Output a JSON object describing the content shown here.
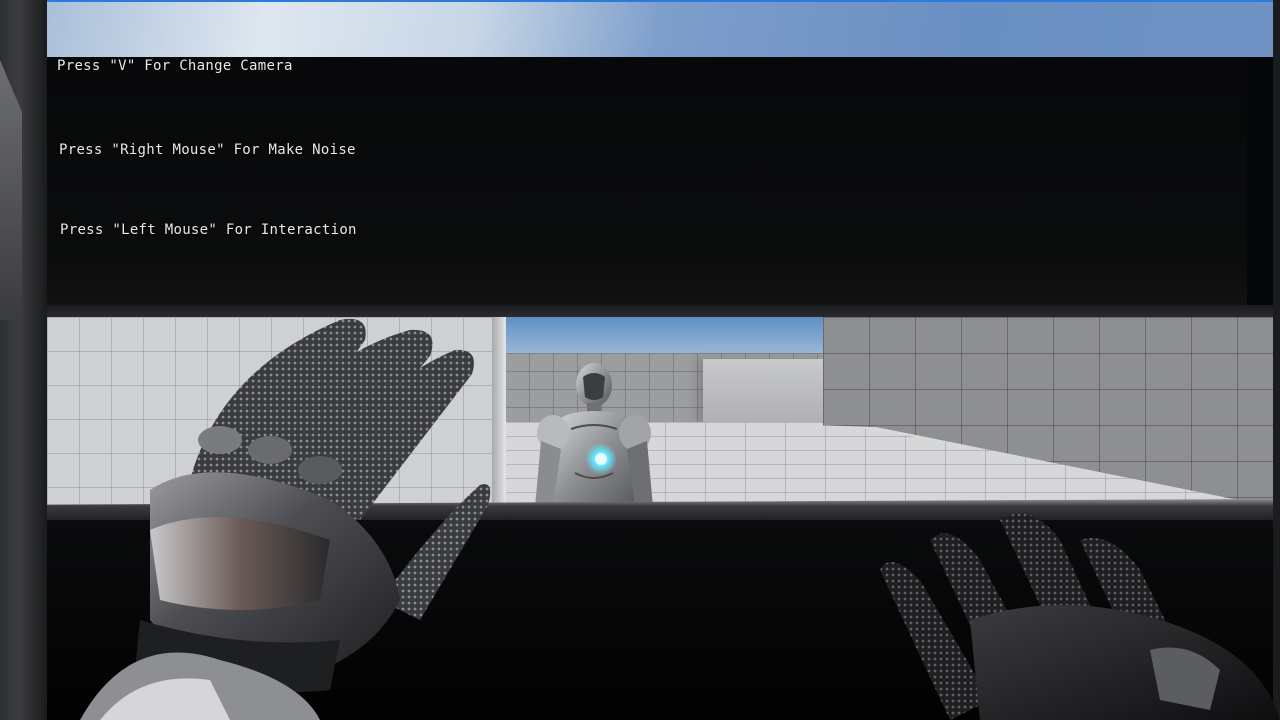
{
  "hud": {
    "lines": [
      "Press \"V\" For Change Camera",
      "Press \"Right Mouse\" For Make Noise",
      "Press \"Left Mouse\" For Interaction"
    ]
  },
  "scene": {
    "character": "robot-npc",
    "hands": [
      "left-gloved-hand",
      "right-gloved-hand"
    ]
  },
  "colors": {
    "accent": "#2a7bdc",
    "hud_text": "#e8e8e8",
    "robot_core_glow": "#63e6ff"
  }
}
